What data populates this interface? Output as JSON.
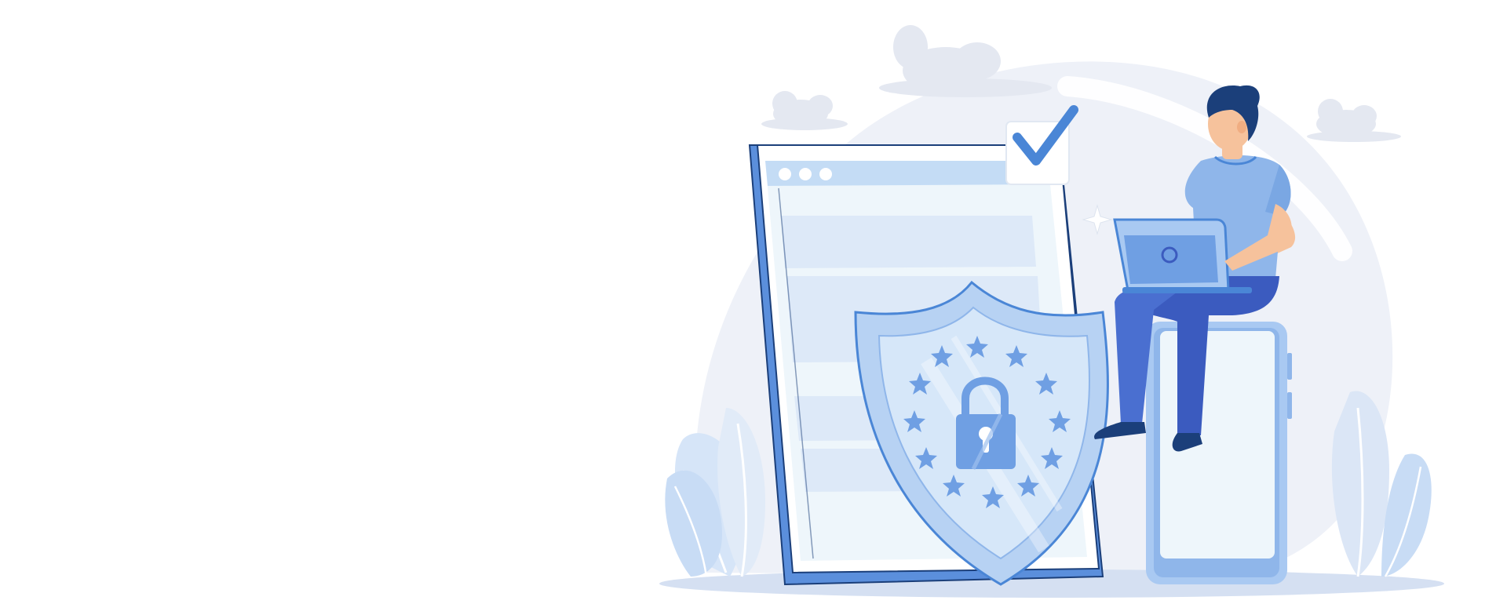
{
  "scene": {
    "subject": "data-protection-illustration",
    "elements": [
      "tablet",
      "shield-icon",
      "padlock-icon",
      "check-icon",
      "person-with-laptop",
      "phone",
      "clouds",
      "plants"
    ]
  },
  "colors": {
    "background": "#ffffff",
    "backdrop": "#eef1f8",
    "primary_blue": "#4a86d6",
    "light_blue": "#a9c9f2",
    "pale_blue": "#e3eefc",
    "navy": "#1b3f7a",
    "indigo": "#3b5bbf",
    "skin": "#f6c29c"
  }
}
